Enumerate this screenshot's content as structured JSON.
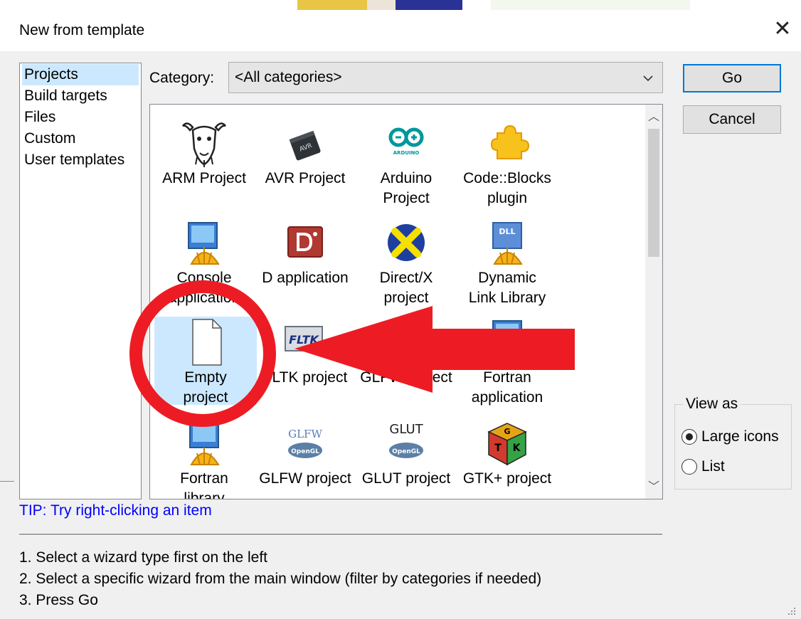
{
  "window": {
    "title": "New from template"
  },
  "sidebar": {
    "items": [
      {
        "label": "Projects",
        "selected": true
      },
      {
        "label": "Build targets"
      },
      {
        "label": "Files"
      },
      {
        "label": "Custom"
      },
      {
        "label": "User templates"
      }
    ]
  },
  "category": {
    "label": "Category:",
    "value": "<All categories>"
  },
  "templates": [
    {
      "label": "ARM Project",
      "icon": "gnu-icon"
    },
    {
      "label": "AVR Project",
      "icon": "avr-chip-icon"
    },
    {
      "label": "Arduino\nProject",
      "icon": "arduino-icon"
    },
    {
      "label": "Code::Blocks\nplugin",
      "icon": "puzzle-piece-icon"
    },
    {
      "label": "Console\napplication",
      "icon": "console-app-icon"
    },
    {
      "label": "D application",
      "icon": "d-app-icon"
    },
    {
      "label": "Direct/X\nproject",
      "icon": "directx-icon"
    },
    {
      "label": "Dynamic\nLink Library",
      "icon": "dll-icon"
    },
    {
      "label": "Empty\nproject",
      "icon": "empty-file-icon",
      "selected": true
    },
    {
      "label": "FLTK project",
      "icon": "fltk-icon"
    },
    {
      "label": "GLFW project",
      "icon": "glfw-opengl-icon"
    },
    {
      "label": "Fortran\napplication",
      "icon": "fortran-app-icon"
    },
    {
      "label": "Fortran\nlibrary",
      "icon": "fortran-lib-icon"
    },
    {
      "label": "GLFW project",
      "icon": "glfw-opengl-icon"
    },
    {
      "label": "GLUT project",
      "icon": "glut-opengl-icon"
    },
    {
      "label": "GTK+ project",
      "icon": "gtk-cube-icon"
    }
  ],
  "icon_texts": {
    "fltk": "FLTK",
    "glfw": "GLFW",
    "glut": "GLUT",
    "opengl": "OpenGL",
    "dll": "DLL",
    "avr": "AVR",
    "arduino": "ARDUINO",
    "gtk": "GTK"
  },
  "buttons": {
    "go": "Go",
    "cancel": "Cancel"
  },
  "view_as": {
    "title": "View as",
    "options": [
      {
        "label": "Large icons",
        "checked": true
      },
      {
        "label": "List",
        "checked": false
      }
    ]
  },
  "tip": "TIP: Try right-clicking an item",
  "instructions": [
    "1. Select a wizard type first on the left",
    "2. Select a specific wizard from the main window (filter by categories if needed)",
    "3. Press Go"
  ],
  "colors": {
    "annotation_red": "#ed1c24",
    "selection": "#cce8ff",
    "tip_blue": "#0000ff"
  }
}
